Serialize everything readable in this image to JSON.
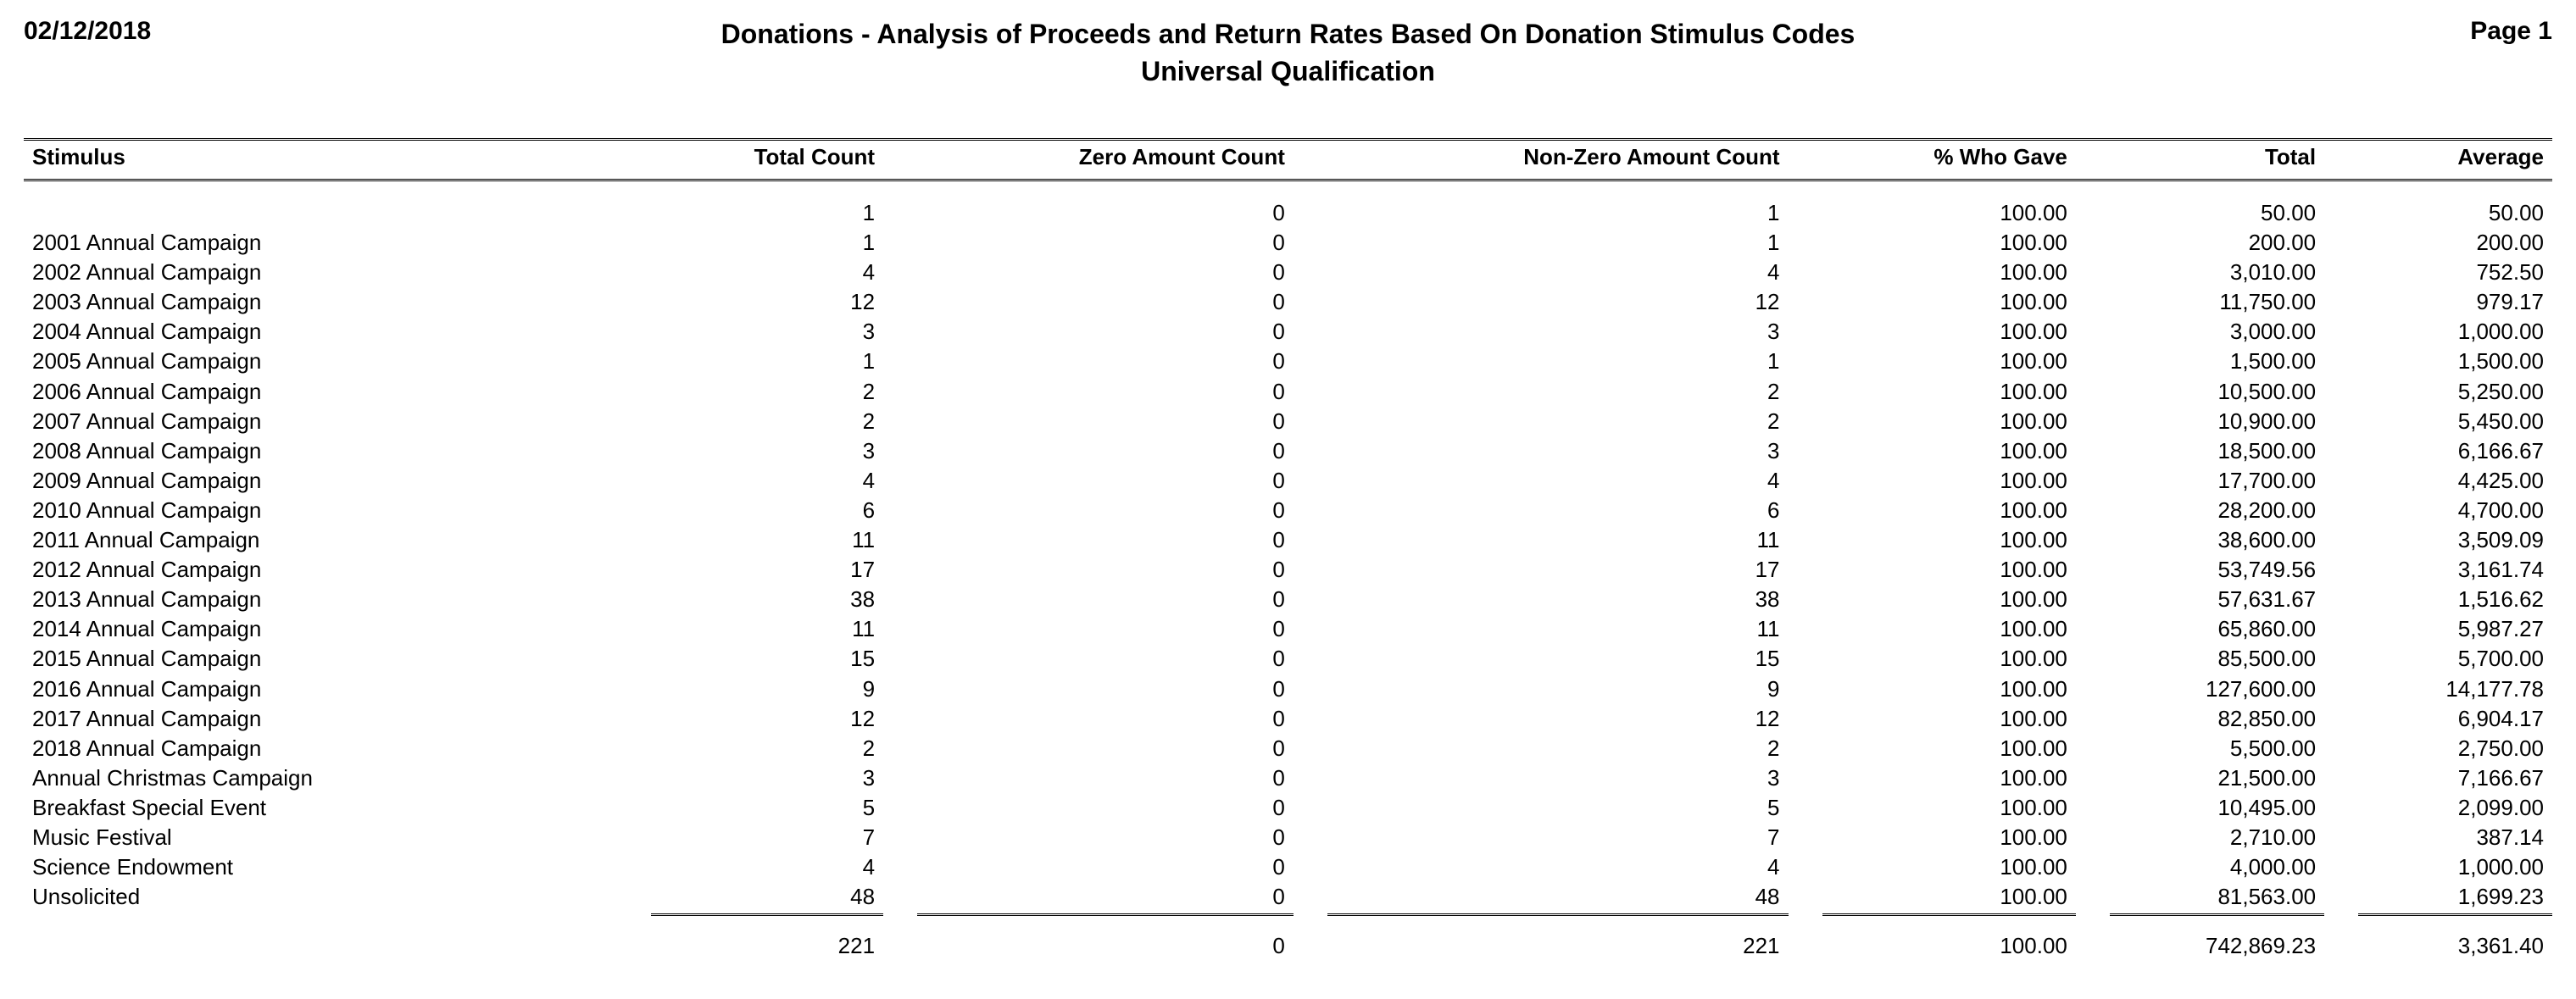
{
  "header": {
    "date": "02/12/2018",
    "title": "Donations - Analysis of Proceeds and Return Rates Based On Donation Stimulus Codes",
    "subtitle": "Universal Qualification",
    "page": "Page 1"
  },
  "columns": {
    "stimulus": "Stimulus",
    "total_count": "Total Count",
    "zero_amount_count": "Zero Amount Count",
    "non_zero_amount_count": "Non-Zero Amount Count",
    "pct_who_gave": "% Who Gave",
    "total": "Total",
    "average": "Average"
  },
  "rows": [
    {
      "stimulus": "",
      "total_count": "1",
      "zero": "0",
      "nonzero": "1",
      "pct": "100.00",
      "total": "50.00",
      "avg": "50.00"
    },
    {
      "stimulus": "2001 Annual Campaign",
      "total_count": "1",
      "zero": "0",
      "nonzero": "1",
      "pct": "100.00",
      "total": "200.00",
      "avg": "200.00"
    },
    {
      "stimulus": "2002 Annual Campaign",
      "total_count": "4",
      "zero": "0",
      "nonzero": "4",
      "pct": "100.00",
      "total": "3,010.00",
      "avg": "752.50"
    },
    {
      "stimulus": "2003 Annual Campaign",
      "total_count": "12",
      "zero": "0",
      "nonzero": "12",
      "pct": "100.00",
      "total": "11,750.00",
      "avg": "979.17"
    },
    {
      "stimulus": "2004 Annual Campaign",
      "total_count": "3",
      "zero": "0",
      "nonzero": "3",
      "pct": "100.00",
      "total": "3,000.00",
      "avg": "1,000.00"
    },
    {
      "stimulus": "2005 Annual Campaign",
      "total_count": "1",
      "zero": "0",
      "nonzero": "1",
      "pct": "100.00",
      "total": "1,500.00",
      "avg": "1,500.00"
    },
    {
      "stimulus": "2006 Annual Campaign",
      "total_count": "2",
      "zero": "0",
      "nonzero": "2",
      "pct": "100.00",
      "total": "10,500.00",
      "avg": "5,250.00"
    },
    {
      "stimulus": "2007 Annual Campaign",
      "total_count": "2",
      "zero": "0",
      "nonzero": "2",
      "pct": "100.00",
      "total": "10,900.00",
      "avg": "5,450.00"
    },
    {
      "stimulus": "2008 Annual Campaign",
      "total_count": "3",
      "zero": "0",
      "nonzero": "3",
      "pct": "100.00",
      "total": "18,500.00",
      "avg": "6,166.67"
    },
    {
      "stimulus": "2009 Annual Campaign",
      "total_count": "4",
      "zero": "0",
      "nonzero": "4",
      "pct": "100.00",
      "total": "17,700.00",
      "avg": "4,425.00"
    },
    {
      "stimulus": "2010 Annual Campaign",
      "total_count": "6",
      "zero": "0",
      "nonzero": "6",
      "pct": "100.00",
      "total": "28,200.00",
      "avg": "4,700.00"
    },
    {
      "stimulus": "2011 Annual Campaign",
      "total_count": "11",
      "zero": "0",
      "nonzero": "11",
      "pct": "100.00",
      "total": "38,600.00",
      "avg": "3,509.09"
    },
    {
      "stimulus": "2012 Annual Campaign",
      "total_count": "17",
      "zero": "0",
      "nonzero": "17",
      "pct": "100.00",
      "total": "53,749.56",
      "avg": "3,161.74"
    },
    {
      "stimulus": "2013 Annual Campaign",
      "total_count": "38",
      "zero": "0",
      "nonzero": "38",
      "pct": "100.00",
      "total": "57,631.67",
      "avg": "1,516.62"
    },
    {
      "stimulus": "2014 Annual Campaign",
      "total_count": "11",
      "zero": "0",
      "nonzero": "11",
      "pct": "100.00",
      "total": "65,860.00",
      "avg": "5,987.27"
    },
    {
      "stimulus": "2015 Annual Campaign",
      "total_count": "15",
      "zero": "0",
      "nonzero": "15",
      "pct": "100.00",
      "total": "85,500.00",
      "avg": "5,700.00"
    },
    {
      "stimulus": "2016 Annual Campaign",
      "total_count": "9",
      "zero": "0",
      "nonzero": "9",
      "pct": "100.00",
      "total": "127,600.00",
      "avg": "14,177.78"
    },
    {
      "stimulus": "2017 Annual Campaign",
      "total_count": "12",
      "zero": "0",
      "nonzero": "12",
      "pct": "100.00",
      "total": "82,850.00",
      "avg": "6,904.17"
    },
    {
      "stimulus": "2018 Annual Campaign",
      "total_count": "2",
      "zero": "0",
      "nonzero": "2",
      "pct": "100.00",
      "total": "5,500.00",
      "avg": "2,750.00"
    },
    {
      "stimulus": "Annual Christmas Campaign",
      "total_count": "3",
      "zero": "0",
      "nonzero": "3",
      "pct": "100.00",
      "total": "21,500.00",
      "avg": "7,166.67"
    },
    {
      "stimulus": "Breakfast Special Event",
      "total_count": "5",
      "zero": "0",
      "nonzero": "5",
      "pct": "100.00",
      "total": "10,495.00",
      "avg": "2,099.00"
    },
    {
      "stimulus": "Music Festival",
      "total_count": "7",
      "zero": "0",
      "nonzero": "7",
      "pct": "100.00",
      "total": "2,710.00",
      "avg": "387.14"
    },
    {
      "stimulus": "Science Endowment",
      "total_count": "4",
      "zero": "0",
      "nonzero": "4",
      "pct": "100.00",
      "total": "4,000.00",
      "avg": "1,000.00"
    },
    {
      "stimulus": "Unsolicited",
      "total_count": "48",
      "zero": "0",
      "nonzero": "48",
      "pct": "100.00",
      "total": "81,563.00",
      "avg": "1,699.23"
    }
  ],
  "totals": {
    "total_count": "221",
    "zero": "0",
    "nonzero": "221",
    "pct": "100.00",
    "total": "742,869.23",
    "avg": "3,361.40"
  }
}
